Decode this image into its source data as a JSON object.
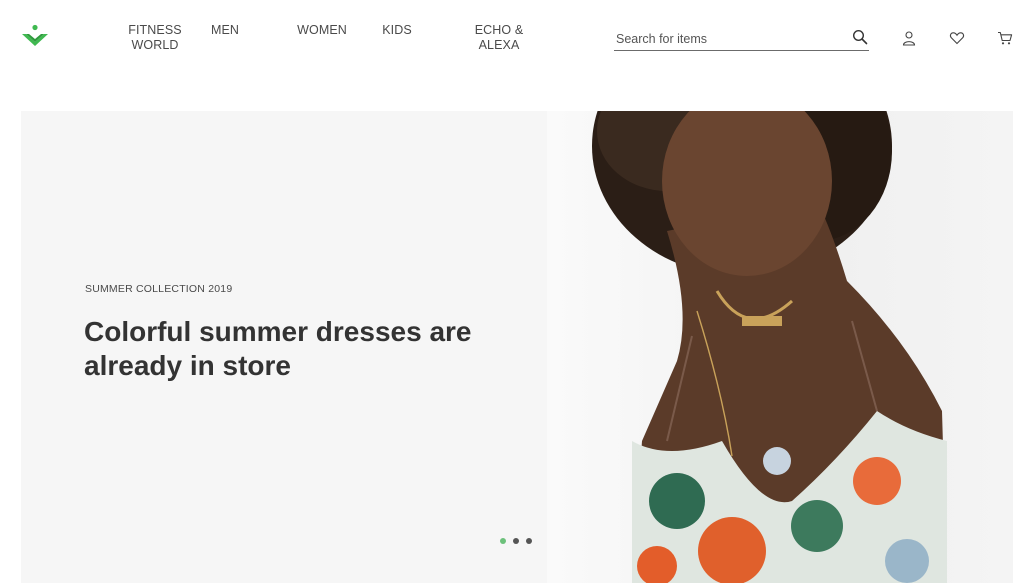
{
  "brand": {
    "logo_icon": "chevron-logo-icon",
    "accent": "#3fb950"
  },
  "nav": {
    "fitness_world": "FITNESS WORLD",
    "men": "MEN",
    "women": "WOMEN",
    "kids": "KIDS",
    "echo_alexa": "ECHO & ALEXA"
  },
  "search": {
    "placeholder": "Search for items",
    "value": "",
    "icon": "search-icon"
  },
  "header_icons": [
    "account-icon",
    "wishlist-heart-icon",
    "cart-icon"
  ],
  "hero": {
    "eyebrow": "SUMMER COLLECTION 2019",
    "headline": "Colorful summer dresses are already in store",
    "slides_total": 3,
    "active_slide": 1,
    "dot_active_color": "#6cc17b",
    "dot_color": "#555555",
    "background": "#f6f6f6"
  }
}
